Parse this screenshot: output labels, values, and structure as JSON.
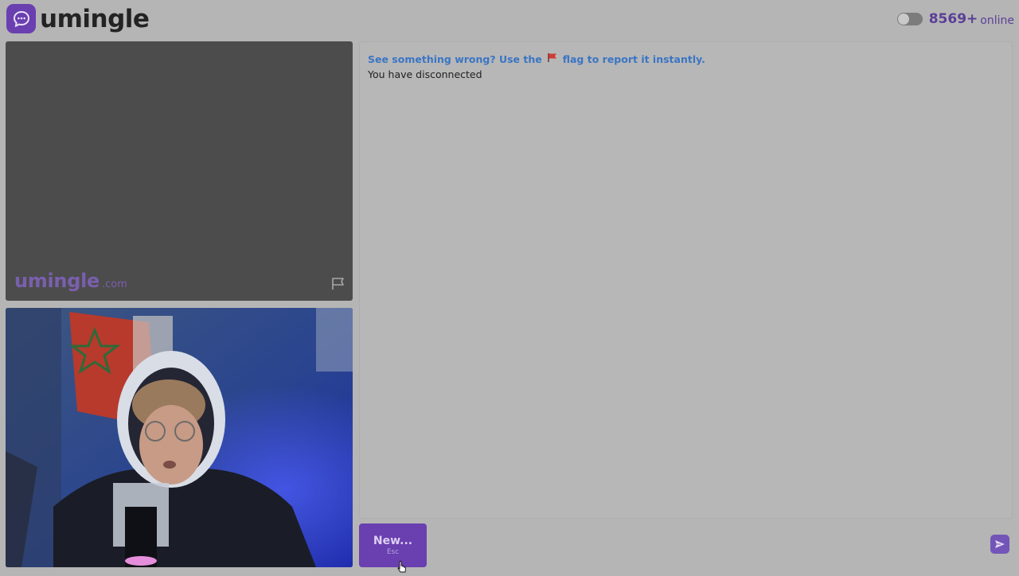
{
  "app": {
    "name": "umingle",
    "logo_icon": "chat-bubble-icon",
    "accent_color": "#6a3fb0"
  },
  "header": {
    "online_count": "8569+",
    "online_label": "online",
    "toggle_icon": "toggle-switch-icon"
  },
  "stranger_video": {
    "watermark_brand": "umingle",
    "watermark_domain": ".com",
    "report_icon": "flag-outline-icon"
  },
  "self_video": {
    "content": "webcam-feed"
  },
  "chat": {
    "notice_before": "See something wrong? Use the",
    "notice_flag_icon": "red-flag-icon",
    "notice_after": "flag to report it instantly.",
    "status_message": "You have disconnected"
  },
  "controls": {
    "new_label": "New...",
    "new_hint": "Esc",
    "input_placeholder": "",
    "send_icon": "send-arrow-icon"
  }
}
